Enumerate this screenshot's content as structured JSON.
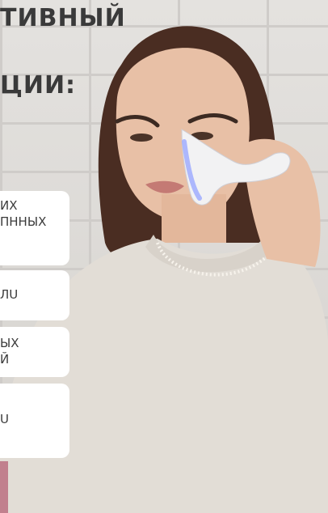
{
  "headings": {
    "line1": "ТИВНЫЙ",
    "line2": "ЦИИ:"
  },
  "cards": [
    {
      "lines": [
        "ИХ",
        "ПННЫХ"
      ]
    },
    {
      "lines": [
        "ЛU"
      ]
    },
    {
      "lines": [
        "ЫХ",
        "Й"
      ]
    },
    {
      "lines": [
        "U"
      ]
    }
  ],
  "colors": {
    "sweater": "#e2ddd6",
    "hair": "#4a2d22",
    "skin": "#e8c0a6",
    "device": "#f2f2f3",
    "device_glow": "#9aa7ff"
  }
}
